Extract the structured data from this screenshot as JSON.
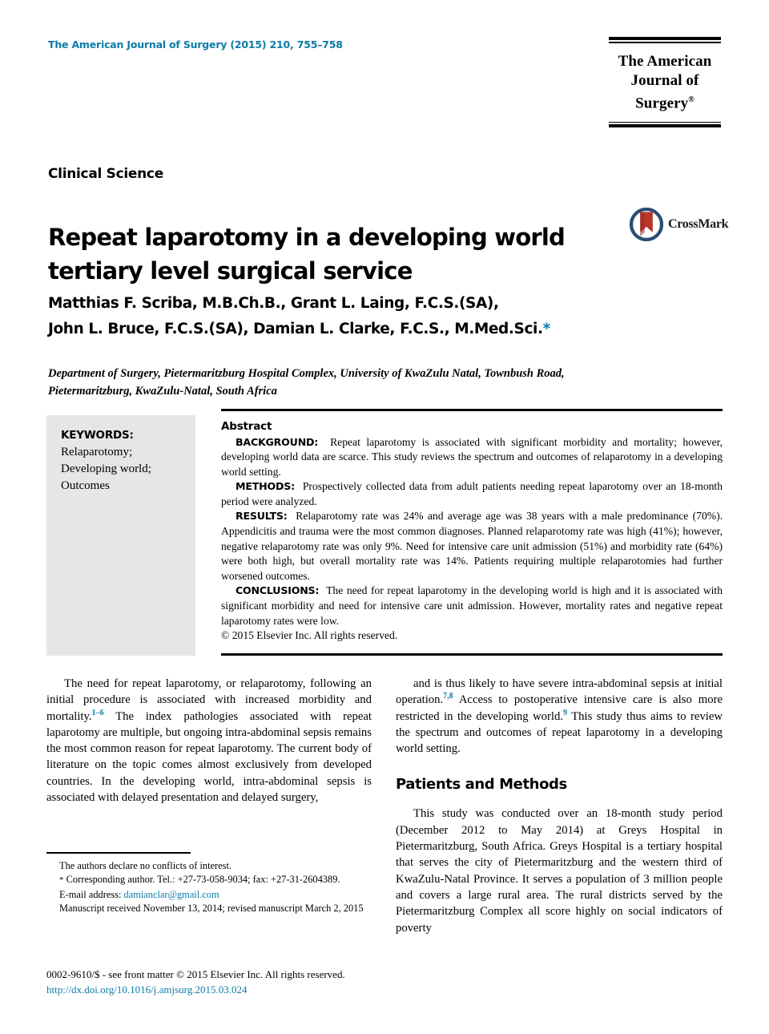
{
  "header": {
    "journal_reference": "The American Journal of Surgery (2015) 210, 755–758",
    "logo_line1": "The American",
    "logo_line2": "Journal of Surgery",
    "logo_registered": "®"
  },
  "article": {
    "section_label": "Clinical Science",
    "title": "Repeat laparotomy in a developing world tertiary level surgical service",
    "crossmark_label": "CrossMark",
    "authors_line1": "Matthias F. Scriba, M.B.Ch.B., Grant L. Laing, F.C.S.(SA),",
    "authors_line2": "John L. Bruce, F.C.S.(SA), Damian L. Clarke, F.C.S., M.Med.Sci.",
    "authors_star": "*",
    "affiliation": "Department of Surgery, Pietermaritzburg Hospital Complex, University of KwaZulu Natal, Townbush Road, Pietermaritzburg, KwaZulu-Natal, South Africa"
  },
  "keywords": {
    "heading": "KEYWORDS:",
    "items": [
      "Relaparotomy;",
      "Developing world;",
      "Outcomes"
    ]
  },
  "abstract": {
    "heading": "Abstract",
    "sections": [
      {
        "label": "BACKGROUND:",
        "text": "Repeat laparotomy is associated with significant morbidity and mortality; however, developing world data are scarce. This study reviews the spectrum and outcomes of relaparotomy in a developing world setting."
      },
      {
        "label": "METHODS:",
        "text": "Prospectively collected data from adult patients needing repeat laparotomy over an 18-month period were analyzed."
      },
      {
        "label": "RESULTS:",
        "text": "Relaparotomy rate was 24% and average age was 38 years with a male predominance (70%). Appendicitis and trauma were the most common diagnoses. Planned relaparotomy rate was high (41%); however, negative relaparotomy rate was only 9%. Need for intensive care unit admission (51%) and morbidity rate (64%) were both high, but overall mortality rate was 14%. Patients requiring multiple relaparotomies had further worsened outcomes."
      },
      {
        "label": "CONCLUSIONS:",
        "text": "The need for repeat laparotomy in the developing world is high and it is associated with significant morbidity and need for intensive care unit admission. However, mortality rates and negative repeat laparotomy rates were low."
      }
    ],
    "copyright": "© 2015 Elsevier Inc. All rights reserved."
  },
  "body": {
    "left_column": {
      "intro_part1": "The need for repeat laparotomy, or relaparotomy, following an initial procedure is associated with increased morbidity and mortality.",
      "intro_cite1": "1–6",
      "intro_part2": " The index pathologies associated with repeat laparotomy are multiple, but ongoing intra-abdominal sepsis remains the most common reason for repeat laparotomy. The current body of literature on the topic comes almost exclusively from developed countries. In the developing world, intra-abdominal sepsis is associated with delayed presentation and delayed surgery,"
    },
    "right_column": {
      "intro_part1": "and is thus likely to have severe intra-abdominal sepsis at initial operation.",
      "intro_cite1": "7,8",
      "intro_part2": " Access to postoperative intensive care is also more restricted in the developing world.",
      "intro_cite2": "9",
      "intro_part3": " This study thus aims to review the spectrum and outcomes of repeat laparotomy in a developing world setting.",
      "methods_heading": "Patients and Methods",
      "methods_para": "This study was conducted over an 18-month study period (December 2012 to May 2014) at Greys Hospital in Pietermaritzburg, South Africa. Greys Hospital is a tertiary hospital that serves the city of Pietermaritzburg and the western third of KwaZulu-Natal Province. It serves a population of 3 million people and covers a large rural area. The rural districts served by the Pietermaritzburg Complex all score highly on social indicators of poverty"
    }
  },
  "footnotes": {
    "conflicts": "The authors declare no conflicts of interest.",
    "corresponding_star": "*",
    "corresponding": "Corresponding author. Tel.: +27-73-058-9034; fax: +27-31-2604389.",
    "email_label": "E-mail address:",
    "email": "damianclar@gmail.com",
    "manuscript": "Manuscript received November 13, 2014; revised manuscript March 2, 2015"
  },
  "page_footer": {
    "issn_line": "0002-9610/$ - see front matter © 2015 Elsevier Inc. All rights reserved.",
    "doi": "http://dx.doi.org/10.1016/j.amjsurg.2015.03.024"
  },
  "colors": {
    "link_blue": "#0b7ba8",
    "keyword_box_gray": "#e6e6e6",
    "crossmark_ring": "#2c4c74",
    "crossmark_ribbon": "#c0392b"
  }
}
